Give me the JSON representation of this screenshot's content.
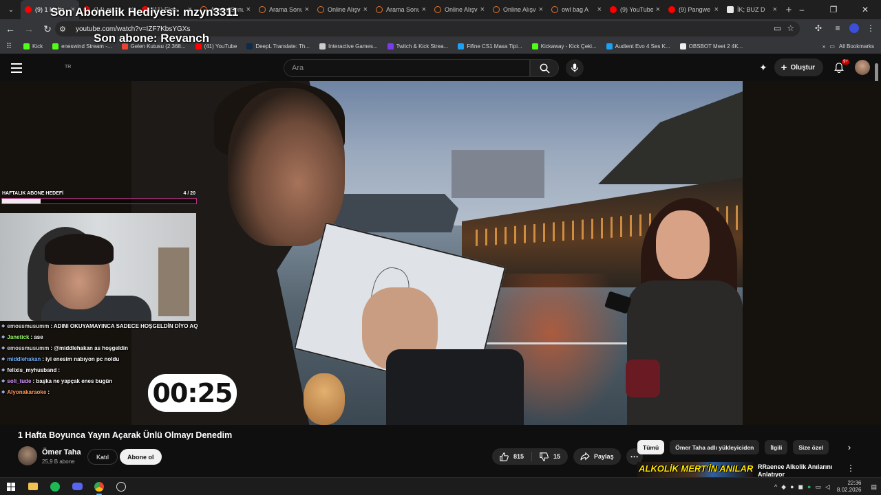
{
  "browser": {
    "tabs": [
      {
        "label": "(9) 1 Hafta",
        "icon": "youtube",
        "active": true
      },
      {
        "label": "(14) oyun",
        "icon": "youtube",
        "active": false
      },
      {
        "label": "(11) Elon",
        "icon": "youtube",
        "active": false
      },
      {
        "label": "Arama Sonuç",
        "icon": "web",
        "active": false
      },
      {
        "label": "Arama Sonuç",
        "icon": "web",
        "active": false
      },
      {
        "label": "Online Alışveriş",
        "icon": "web",
        "active": false
      },
      {
        "label": "Arama Sonuç",
        "icon": "web",
        "active": false
      },
      {
        "label": "Online Alışveriş",
        "icon": "web",
        "active": false
      },
      {
        "label": "Online Alışveriş",
        "icon": "web",
        "active": false
      },
      {
        "label": "owl bag A",
        "icon": "web",
        "active": false
      },
      {
        "label": "(9) YouTube",
        "icon": "youtube",
        "active": false
      },
      {
        "label": "(9) Pangwe",
        "icon": "youtube",
        "active": false
      },
      {
        "label": "İK; BUZ D",
        "icon": "doc",
        "active": false
      }
    ],
    "url": "youtube.com/watch?v=IZF7KbsYGXs",
    "bookmarks": [
      {
        "label": "Kick",
        "color": "#53fc18"
      },
      {
        "label": "eneswind Stream -...",
        "color": "#53fc18"
      },
      {
        "label": "Gelen Kutusu (2.368...",
        "color": "#ea4335"
      },
      {
        "label": "(41) YouTube",
        "color": "#ff0000"
      },
      {
        "label": "DeepL Translate: Th...",
        "color": "#0f2b46"
      },
      {
        "label": "Interactive Games...",
        "color": "#cccccc"
      },
      {
        "label": "Twitch & Kick Strea...",
        "color": "#7c3aed"
      },
      {
        "label": "Fifine CS1 Masa Tipi...",
        "color": "#1da1f2"
      },
      {
        "label": "Kickaway - Kick Çeki...",
        "color": "#53fc18"
      },
      {
        "label": "Audient Evo 4 Ses K...",
        "color": "#1da1f2"
      },
      {
        "label": "OBSBOT Meet 2 4K...",
        "color": "#eeeeee"
      }
    ],
    "all_bookmarks": "All Bookmarks"
  },
  "overlay": {
    "last_gift": "Son Abonelik Hediyesi: mzyn3311",
    "last_sub": "Son abone: Revanch",
    "goal_label": "HAFTALIK ABONE HEDEFİ",
    "goal_count": "4  / 20",
    "goal_progress": 0.2,
    "timer": "00:25",
    "chat": [
      {
        "user": "emossmusumm",
        "text": ": ADINI OKUYAMAYINCA SADECE HOŞGELDİN DİYO AQ",
        "color": "#dcdcdc"
      },
      {
        "user": "Janetick",
        "text": ": ase",
        "color": "#9bff6a"
      },
      {
        "user": "emossmusumm",
        "text": ": @middlehakan as hoşgeldin",
        "color": "#dcdcdc"
      },
      {
        "user": "middlehakan",
        "text": ": iyi enesim nabıyon pc noldu",
        "color": "#6fb3ff"
      },
      {
        "user": "felixis_myhusband",
        "text": ": ",
        "color": "#ffffff"
      },
      {
        "user": "soli_tude",
        "text": ": başka ne yapçak enes bugün",
        "color": "#d69bff"
      },
      {
        "user": "Alyonakaraoke",
        "text": ": ",
        "color": "#ff9a5a"
      }
    ]
  },
  "youtube": {
    "region": "TR",
    "search_placeholder": "Ara",
    "create_label": "Oluştur",
    "notif_badge": "9+",
    "video_title": "1 Hafta Boyunca Yayın Açarak Ünlü Olmayı Denedim",
    "channel_name": "Ömer Taha",
    "channel_subs": "25,9 B abone",
    "join_label": "Katıl",
    "subscribe_label": "Abone ol",
    "likes": "815",
    "dislikes": "15",
    "share_label": "Paylaş",
    "chips": [
      {
        "label": "Tümü",
        "active": true
      },
      {
        "label": "Ömer Taha adlı yükleyiciden",
        "active": false
      },
      {
        "label": "İlgili",
        "active": false
      },
      {
        "label": "Size özel",
        "active": false
      }
    ],
    "rec_thumb_text": "ALKOLİK MERT'İN ANILARI",
    "rec_title": "RRaenee Alkolik Anılarını Anlatıyor"
  },
  "taskbar": {
    "time": "22:36",
    "date": "8.02.2026"
  }
}
